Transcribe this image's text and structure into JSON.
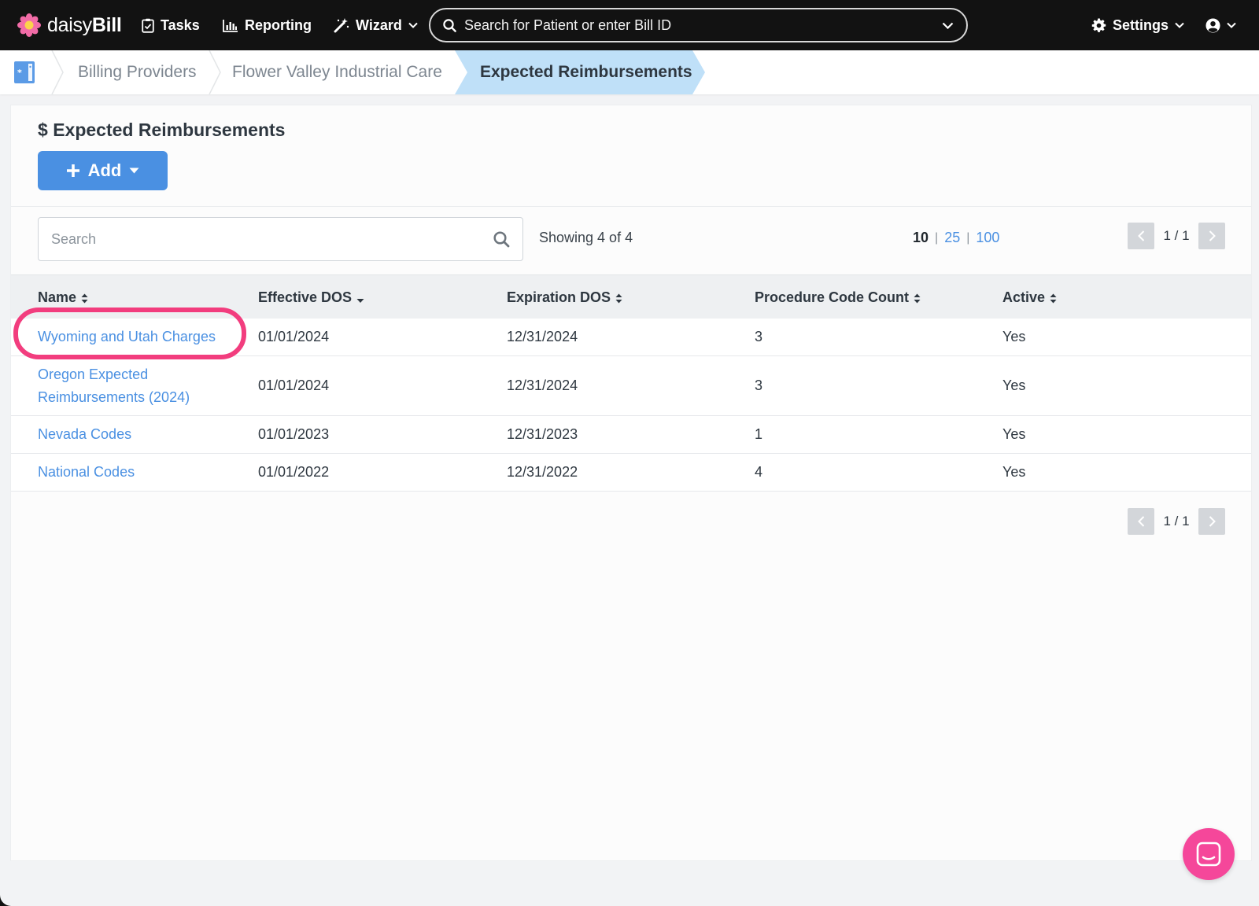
{
  "app": {
    "brand_light": "daisy",
    "brand_bold": "Bill"
  },
  "topnav": {
    "tasks": "Tasks",
    "reporting": "Reporting",
    "wizard": "Wizard",
    "search_placeholder": "Search for Patient or enter Bill ID",
    "settings": "Settings"
  },
  "breadcrumb": {
    "items": [
      "Billing Providers",
      "Flower Valley Industrial Care"
    ],
    "current": "Expected Reimbursements"
  },
  "page": {
    "title": "Expected Reimbursements",
    "add_label": "Add"
  },
  "toolbar": {
    "search_placeholder": "Search",
    "showing": "Showing 4 of 4",
    "page_sizes": [
      "10",
      "25",
      "100"
    ],
    "page_size_sep": "|",
    "pager_label": "1 / 1"
  },
  "table": {
    "columns": [
      "Name",
      "Effective DOS",
      "Expiration DOS",
      "Procedure Code Count",
      "Active"
    ],
    "rows": [
      {
        "name": "Wyoming and Utah Charges",
        "effective": "01/01/2024",
        "expiration": "12/31/2024",
        "count": "3",
        "active": "Yes"
      },
      {
        "name": "Oregon Expected Reimbursements (2024)",
        "effective": "01/01/2024",
        "expiration": "12/31/2024",
        "count": "3",
        "active": "Yes"
      },
      {
        "name": "Nevada Codes",
        "effective": "01/01/2023",
        "expiration": "12/31/2023",
        "count": "1",
        "active": "Yes"
      },
      {
        "name": "National Codes",
        "effective": "01/01/2022",
        "expiration": "12/31/2022",
        "count": "4",
        "active": "Yes"
      }
    ]
  },
  "colors": {
    "accent": "#4a90e2",
    "highlight": "#f23d7e",
    "chat": "#f5479a",
    "nav_bg": "#121212",
    "breadcrumb_active": "#bfe0f8"
  },
  "icons": {
    "logo": "daisy-flower-icon",
    "tasks": "clipboard-check-icon",
    "reporting": "bar-chart-icon",
    "wizard": "magic-wand-icon",
    "search": "search-icon",
    "settings": "gear-icon",
    "user": "user-circle-icon",
    "home": "address-card-icon",
    "chat": "chat-icon"
  }
}
